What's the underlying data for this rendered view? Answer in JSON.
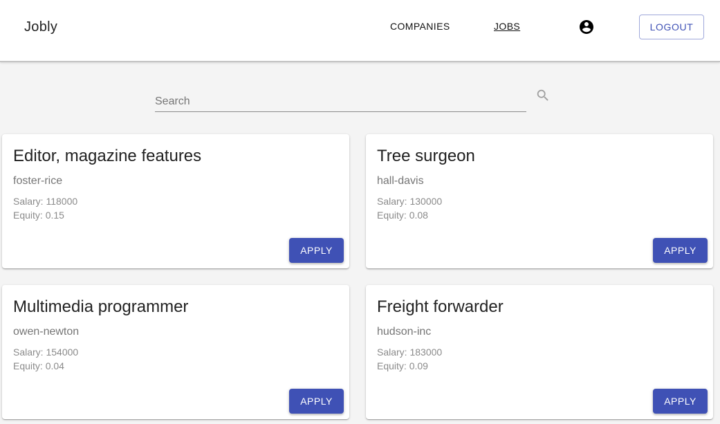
{
  "header": {
    "brand": "Jobly",
    "nav": {
      "companies": "COMPANIES",
      "jobs": "JOBS"
    },
    "profile_icon": "account-circle-icon",
    "logout_label": "LOGOUT"
  },
  "search": {
    "placeholder": "Search",
    "value": "",
    "icon": "search-icon"
  },
  "jobs": [
    {
      "title": "Editor, magazine features",
      "company": "foster-rice",
      "salary": "Salary: 118000",
      "equity": "Equity: 0.15",
      "apply_label": "APPLY"
    },
    {
      "title": "Tree surgeon",
      "company": "hall-davis",
      "salary": "Salary: 130000",
      "equity": "Equity: 0.08",
      "apply_label": "APPLY"
    },
    {
      "title": "Multimedia programmer",
      "company": "owen-newton",
      "salary": "Salary: 154000",
      "equity": "Equity: 0.04",
      "apply_label": "APPLY"
    },
    {
      "title": "Freight forwarder",
      "company": "hudson-inc",
      "salary": "Salary: 183000",
      "equity": "Equity: 0.09",
      "apply_label": "APPLY"
    }
  ],
  "colors": {
    "primary": "#3f51b5",
    "background": "#f4f4f4",
    "card": "#ffffff"
  }
}
